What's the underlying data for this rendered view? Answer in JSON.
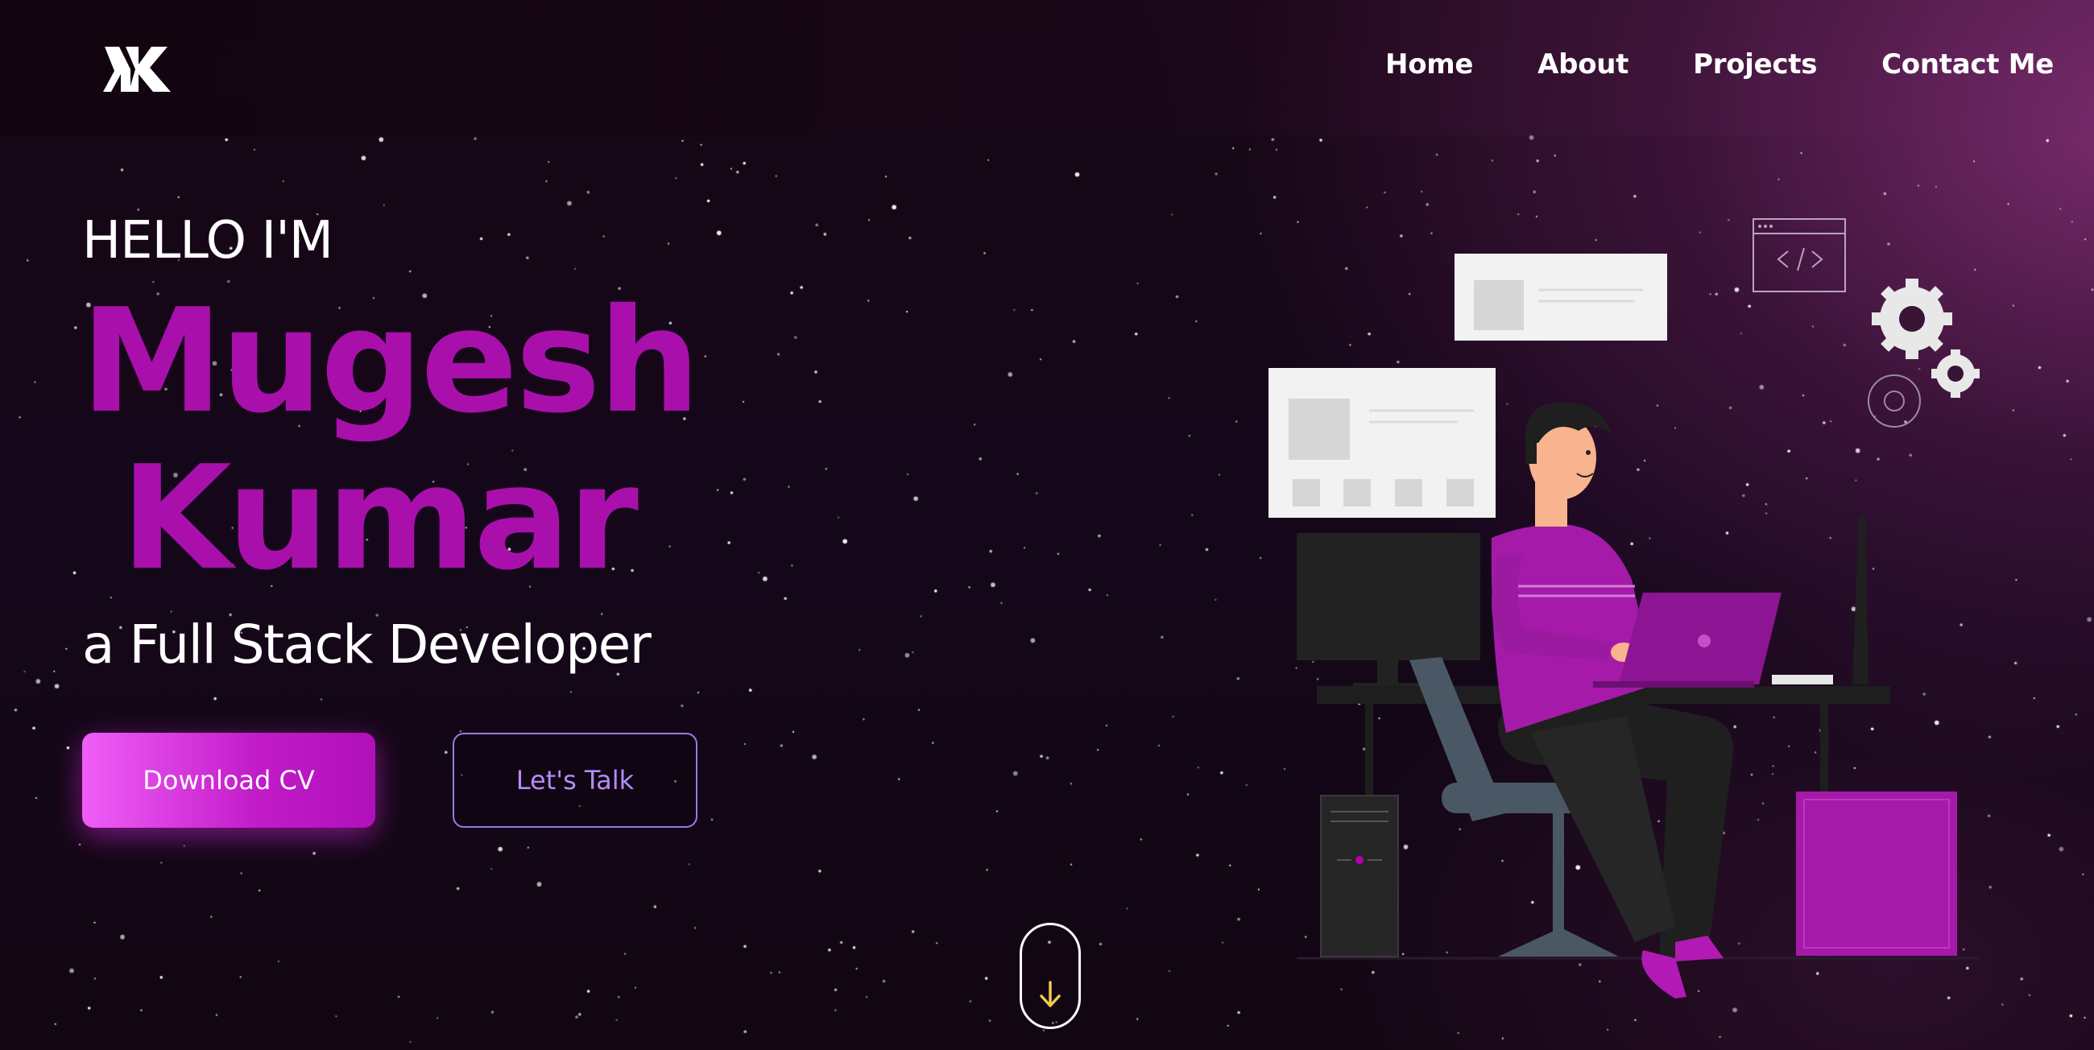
{
  "header": {
    "logo_text": "MK",
    "nav": [
      {
        "label": "Home"
      },
      {
        "label": "About"
      },
      {
        "label": "Projects"
      },
      {
        "label": "Contact Me"
      }
    ]
  },
  "hero": {
    "greeting": "HELLO I'M",
    "name_line1": "Mugesh",
    "name_line2": "Kumar",
    "role": "a Full Stack Developer",
    "primary_button": "Download CV",
    "secondary_button": "Let's Talk"
  },
  "scroll": {
    "icon": "arrow-down-icon"
  },
  "colors": {
    "accent": "#a90fab",
    "button_gradient_start": "#f05ef7",
    "button_gradient_end": "#b010b8",
    "outline_button": "#9b7be0",
    "scroll_arrow": "#f2c94c",
    "background": "#14071a"
  }
}
